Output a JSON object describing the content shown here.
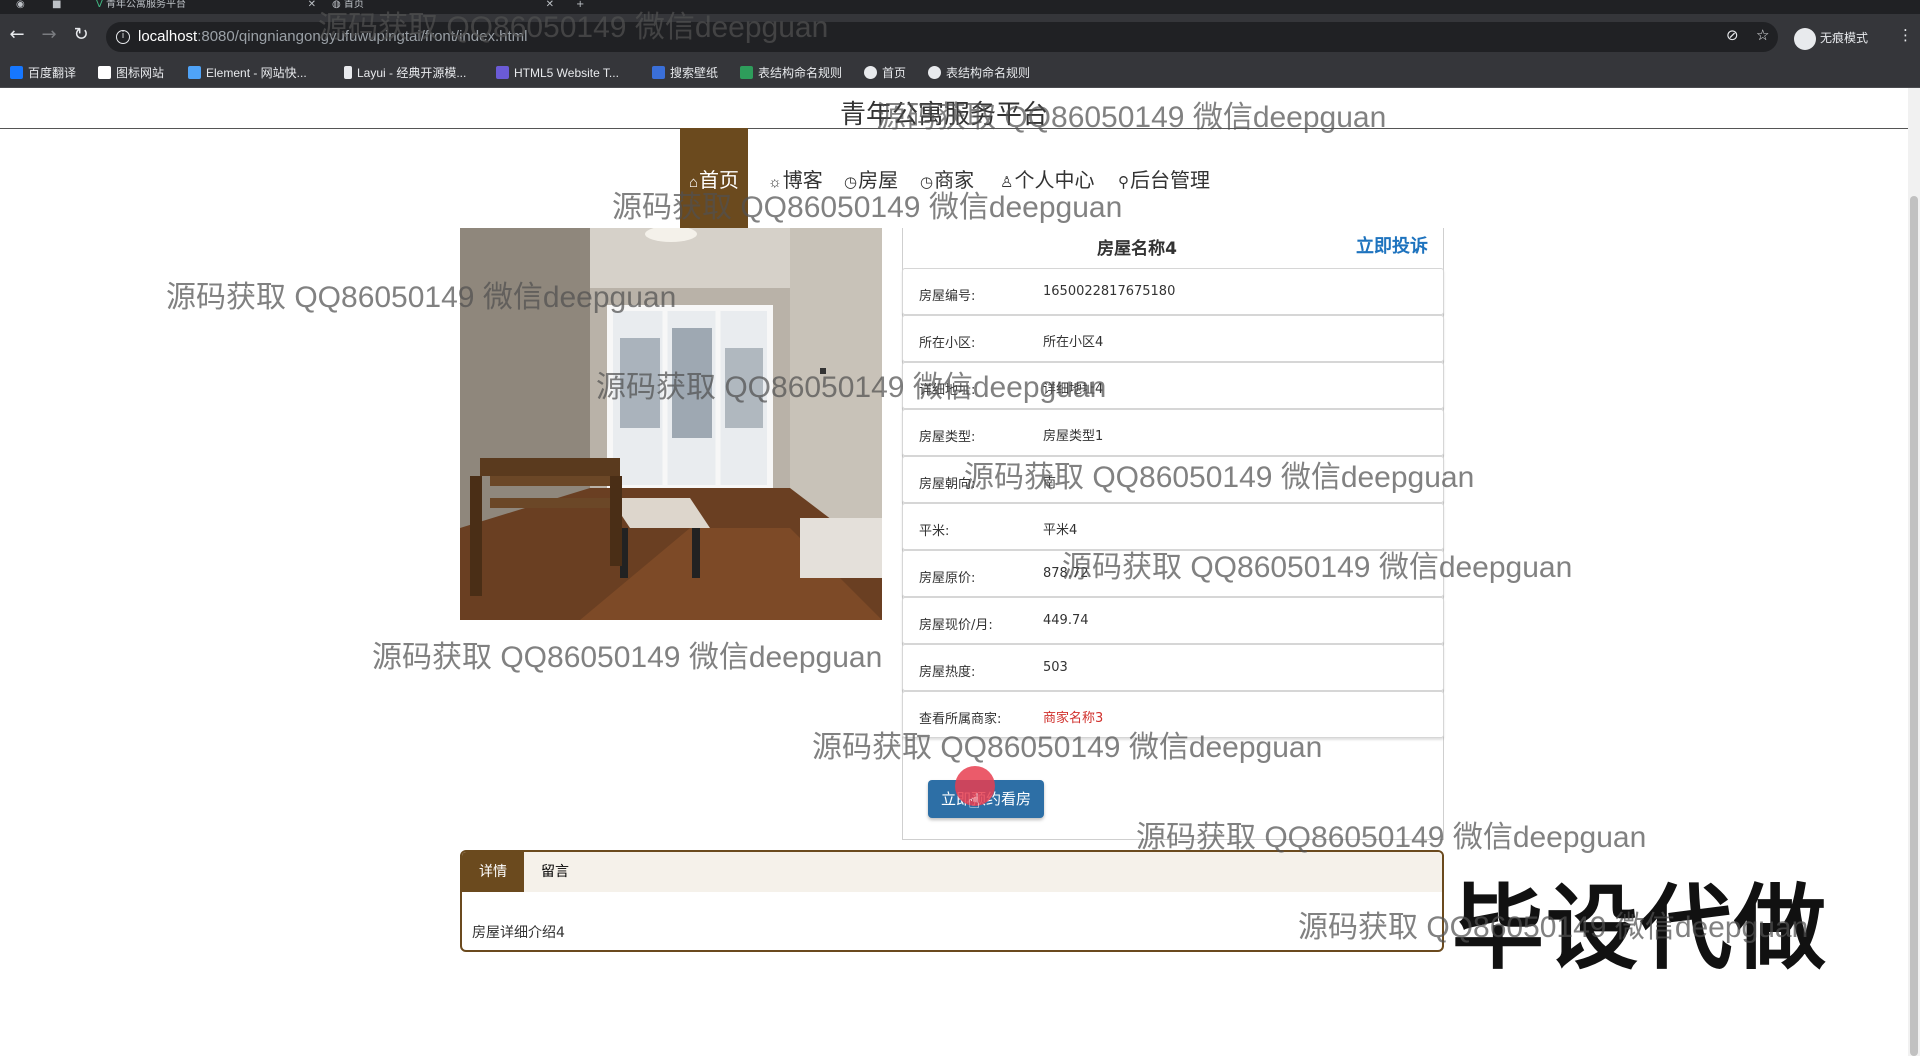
{
  "browser": {
    "tabs": [
      {
        "title": "青年公寓服务平台"
      },
      {
        "title": "首页"
      }
    ],
    "new_tab": "+",
    "url_host": "localhost",
    "url_port": ":8080",
    "url_path": "/qingniangongyufuwupingtai/front/index.html",
    "profile_label": "无痕模式",
    "bookmarks": [
      "百度翻译",
      "图标网站",
      "Element - 网站快...",
      "Layui - 经典开源模...",
      "HTML5 Website T...",
      "搜索壁纸",
      "表结构命名规则",
      "首页",
      "表结构命名规则"
    ],
    "bookmark_colors": [
      "#1677ff",
      "#ffffff",
      "#4fa3f7",
      "#ffffff",
      "#6b5bd6",
      "#3a6fd8",
      "#2e9d5b",
      "#e8eaed",
      "#e8eaed"
    ]
  },
  "site": {
    "title": "青年公寓服务平台",
    "nav": [
      {
        "icon": "⌂",
        "label": "首页"
      },
      {
        "icon": "☼",
        "label": "博客"
      },
      {
        "icon": "◷",
        "label": "房屋"
      },
      {
        "icon": "◷",
        "label": "商家"
      },
      {
        "icon": "♙",
        "label": "个人中心"
      },
      {
        "icon": "⚲",
        "label": "后台管理"
      }
    ]
  },
  "house": {
    "name": "房屋名称4",
    "complain_label": "立即投诉",
    "fields": [
      {
        "label": "房屋编号:",
        "value": "1650022817675180"
      },
      {
        "label": "所在小区:",
        "value": "所在小区4"
      },
      {
        "label": "详细地址:",
        "value": "详细地址4"
      },
      {
        "label": "房屋类型:",
        "value": "房屋类型1"
      },
      {
        "label": "房屋朝向:",
        "value": "南"
      },
      {
        "label": "平米:",
        "value": "平米4"
      },
      {
        "label": "房屋原价:",
        "value": "878.72"
      },
      {
        "label": "房屋现价/月:",
        "value": "449.74"
      },
      {
        "label": "房屋热度:",
        "value": "503"
      },
      {
        "label": "查看所属商家:",
        "value": "商家名称3"
      }
    ],
    "book_label": "立即预约看房",
    "tabs": [
      {
        "label": "详情"
      },
      {
        "label": "留言"
      }
    ],
    "detail_text": "房屋详细介绍4"
  },
  "overlay": {
    "watermark": "源码获取 QQ86050149 微信deepguan",
    "stamp": "毕设代做"
  }
}
